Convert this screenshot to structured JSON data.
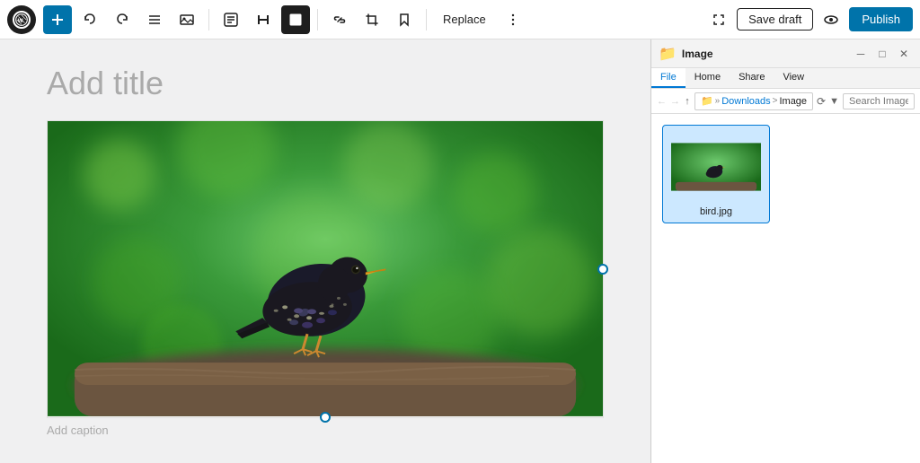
{
  "toolbar": {
    "add_label": "+",
    "undo_label": "↩",
    "redo_label": "↪",
    "list_view_label": "≡",
    "image_label": "🖼",
    "text_label": "T",
    "block_label": "□",
    "link_label": "🔗",
    "crop_label": "⌧",
    "bookmark_label": "🔖",
    "replace_label": "Replace",
    "more_label": "⋮",
    "distraction_free_label": "«",
    "save_draft_label": "Save draft",
    "view_label": "👁",
    "publish_label": "Publish"
  },
  "editor": {
    "title_placeholder": "Add title",
    "caption_placeholder": "Add caption",
    "image_alt": "A starling bird perched on a branch with green bokeh background"
  },
  "file_explorer": {
    "window_title": "Image",
    "tabs": [
      "File",
      "Home",
      "Share",
      "View"
    ],
    "active_tab": "File",
    "nav": {
      "back_label": "←",
      "forward_label": "→",
      "up_label": "↑",
      "path_parts": [
        "Downloads",
        ">",
        "Image"
      ],
      "search_placeholder": "Search Image",
      "refresh_label": "⟳"
    },
    "files": [
      {
        "name": "bird.jpg",
        "selected": true
      }
    ]
  }
}
